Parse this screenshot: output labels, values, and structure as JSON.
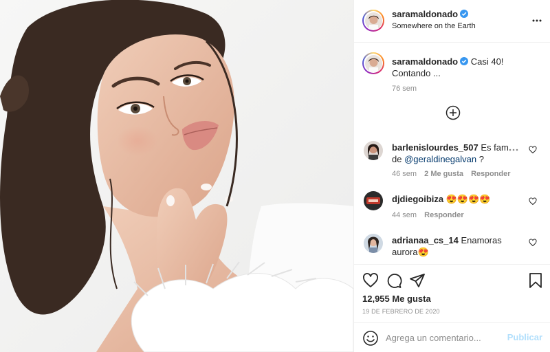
{
  "post": {
    "author": "saramaldonado",
    "location": "Somewhere on the Earth",
    "caption": "Casi 40!",
    "caption_line2": "Contando ...",
    "caption_age": "76 sem",
    "verified_color": "#3897f0"
  },
  "comments": [
    {
      "user": "barlenislourdes_507",
      "text": "Es fam",
      "mention": "@geraldinegalvan",
      "mention_prefix": "de",
      "mention_suffix": "?",
      "age": "46 sem",
      "likes": "2 Me gusta",
      "reply": "Responder"
    },
    {
      "user": "djdiegoibiza",
      "text": "😍😍😍😍",
      "age": "44 sem",
      "reply": "Responder"
    },
    {
      "user": "adrianaa_cs_14",
      "text": "Enamoras",
      "text_line2": "aurora😍"
    }
  ],
  "footer": {
    "likes": "12,955 Me gusta",
    "date": "19 DE FEBRERO DE 2020",
    "comment_placeholder": "Agrega un comentario...",
    "publish_label": "Publicar"
  },
  "icons": {
    "heart": "heart-icon",
    "comment": "comment-icon",
    "share": "share-icon",
    "save": "bookmark-icon",
    "emoji": "emoji-icon",
    "more": "more-options-icon",
    "load_more": "plus-circle-icon"
  },
  "colors": {
    "text": "#262626",
    "muted": "#8e8e8e",
    "link": "#00376b",
    "publish_disabled": "#b2dffc"
  }
}
